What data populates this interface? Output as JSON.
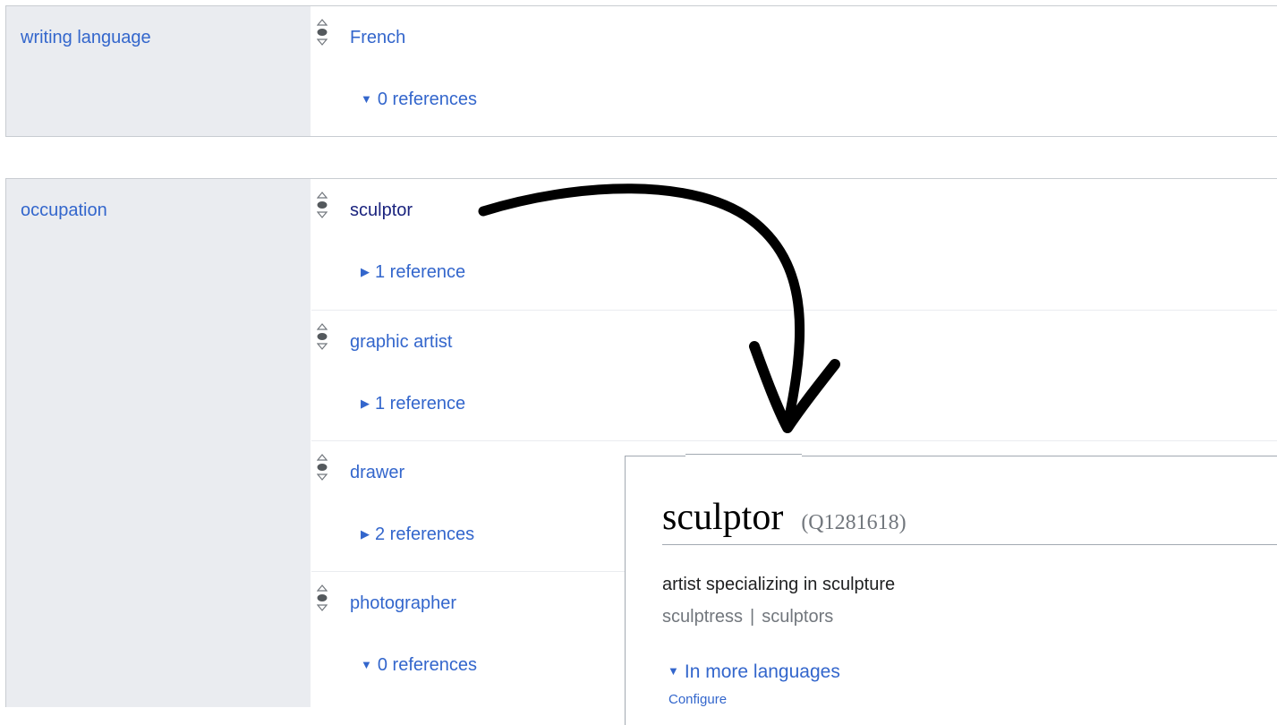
{
  "writing_language": {
    "label": "writing language",
    "statements": [
      {
        "value": "French",
        "references": "0 references"
      }
    ]
  },
  "occupation": {
    "label": "occupation",
    "statements": [
      {
        "value": "sculptor",
        "references": "1 reference"
      },
      {
        "value": "graphic artist",
        "references": "1 reference"
      },
      {
        "value": "drawer",
        "references": "2 references"
      },
      {
        "value": "photographer",
        "references": "0 references"
      }
    ]
  },
  "icons": {
    "rank": "rank-selector-icon",
    "collapsed": "triangle-right-icon",
    "expanded": "triangle-down-icon",
    "annotation": "hand-drawn-arrow"
  },
  "popup": {
    "title": "sculptor",
    "qid": "(Q1281618)",
    "description": "artist specializing in sculpture",
    "aliases": [
      "sculptress",
      "sculptors"
    ],
    "alias_separator": "|",
    "more_languages": "In more languages",
    "configure": "Configure"
  },
  "colors": {
    "link": "#3366cc",
    "visited_link": "#1a237e",
    "label_bg": "#eaecf0",
    "border": "#c8ccd1",
    "muted": "#72777d"
  }
}
